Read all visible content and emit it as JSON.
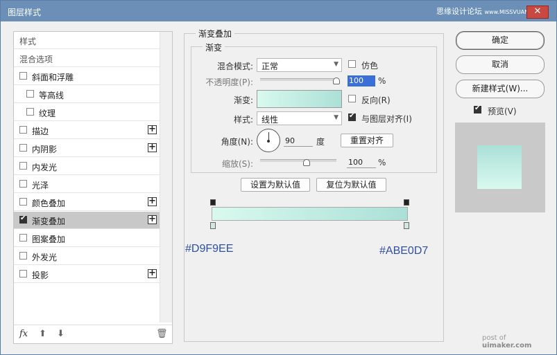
{
  "window": {
    "title": "图层样式",
    "watermark": "思缘设计论坛",
    "watermark_url": "www.MISSVUAN.COM",
    "footer_watermark_prefix": "post of",
    "footer_watermark_site": "uimaker.com"
  },
  "left": {
    "header": "样式",
    "blend_options": "混合选项",
    "items": [
      {
        "label": "斜面和浮雕",
        "checked": false,
        "plus": false,
        "indent": 0
      },
      {
        "label": "等高线",
        "checked": false,
        "plus": false,
        "indent": 1
      },
      {
        "label": "纹理",
        "checked": false,
        "plus": false,
        "indent": 1
      },
      {
        "label": "描边",
        "checked": false,
        "plus": true,
        "indent": 0
      },
      {
        "label": "内阴影",
        "checked": false,
        "plus": true,
        "indent": 0
      },
      {
        "label": "内发光",
        "checked": false,
        "plus": false,
        "indent": 0
      },
      {
        "label": "光泽",
        "checked": false,
        "plus": false,
        "indent": 0
      },
      {
        "label": "颜色叠加",
        "checked": false,
        "plus": true,
        "indent": 0
      },
      {
        "label": "渐变叠加",
        "checked": true,
        "plus": true,
        "indent": 0,
        "selected": true
      },
      {
        "label": "图案叠加",
        "checked": false,
        "plus": false,
        "indent": 0
      },
      {
        "label": "外发光",
        "checked": false,
        "plus": false,
        "indent": 0
      },
      {
        "label": "投影",
        "checked": false,
        "plus": true,
        "indent": 0
      }
    ],
    "fx_label": "fx"
  },
  "gradient_overlay": {
    "group_title": "渐变叠加",
    "sub_title": "渐变",
    "blend_mode_label": "混合模式:",
    "blend_mode_value": "正常",
    "dither_label": "仿色",
    "opacity_label": "不透明度(P):",
    "opacity_value": "100",
    "percent": "%",
    "gradient_label": "渐变:",
    "reverse_label": "反向(R)",
    "style_label": "样式:",
    "style_value": "线性",
    "align_label": "与图层对齐(I)",
    "angle_label": "角度(N):",
    "angle_value": "90",
    "degree_unit": "度",
    "reset_align": "重置对齐",
    "scale_label": "缩放(S):",
    "scale_value": "100",
    "set_default": "设置为默认值",
    "reset_default": "复位为默认值",
    "color_start": "#D9F9EE",
    "color_end": "#ABE0D7"
  },
  "right": {
    "ok": "确定",
    "cancel": "取消",
    "new_style": "新建样式(W)...",
    "preview_label": "预览(V)"
  }
}
